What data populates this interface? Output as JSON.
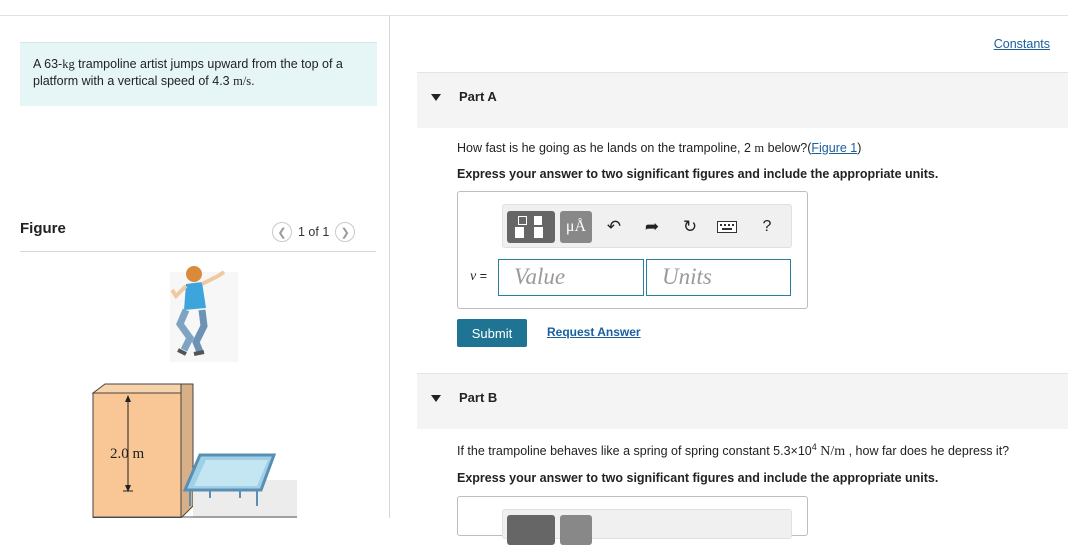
{
  "problem": {
    "text_before_mass": "A 63-",
    "mass_unit": "kg",
    "text_after_mass": " trampoline artist jumps upward from the top of a platform with a vertical speed of 4.3 ",
    "speed_unit": "m/s",
    "text_end": "."
  },
  "figure": {
    "label": "Figure",
    "pager": "1 of 1",
    "height_label": "2.0 m"
  },
  "header": {
    "constants_link": "Constants"
  },
  "partA": {
    "title": "Part A",
    "question_before": "How fast is he going as he lands on the trampoline, 2 ",
    "question_unit": "m",
    "question_after": " below?(",
    "figure_link": "Figure 1",
    "question_close": ")",
    "instruction": "Express your answer to two significant figures and include the appropriate units.",
    "units_button": "μÅ",
    "help_button": "?",
    "variable": "v",
    "equals": " =",
    "value_placeholder": "Value",
    "units_placeholder": "Units",
    "submit": "Submit",
    "request_answer": "Request Answer"
  },
  "partB": {
    "title": "Part B",
    "question_before": "If the trampoline behaves like a spring of spring constant 5.3×10",
    "question_exp": "4",
    "question_unit": " N/m",
    "question_after": " , how far does he depress it?",
    "instruction": "Express your answer to two significant figures and include the appropriate units."
  },
  "colors": {
    "problem_bg": "#e6f6f7",
    "link": "#1a5fa0",
    "submit_bg": "#1f7493",
    "input_border": "#2a7ea0"
  },
  "icons": [
    "chevron-left-icon",
    "chevron-right-icon",
    "expand-triangle-icon",
    "template-icon",
    "undo-icon",
    "redo-icon",
    "reset-icon",
    "keyboard-icon",
    "help-icon"
  ]
}
